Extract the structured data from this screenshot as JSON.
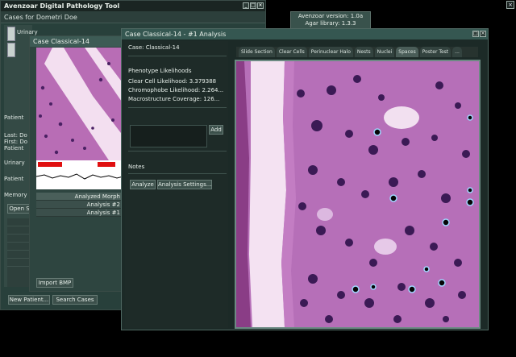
{
  "app": {
    "title": "Avenzoar Digital Pathology Tool",
    "tab": "Cases for Dometri Doe"
  },
  "info": {
    "version_line": "Avenzoar version: 1.0a",
    "library_line": "Agar library: 1.3.3"
  },
  "main": {
    "side_rows": [
      "Urinary",
      "Patient",
      "Last: Do",
      "First: Do",
      "Patient",
      "Urinary",
      "Patient",
      "Memory"
    ],
    "open_button": "Open S",
    "new_patient_button": "New Patient...",
    "search_cases_button": "Search Cases"
  },
  "case_window": {
    "title": "Case Classical-14",
    "analyses_header": "Analyzed Morph",
    "analyses": [
      "Analysis #2",
      "Analysis #1"
    ],
    "import_button": "Import BMP"
  },
  "analysis_window": {
    "title": "Case Classical-14 - #1 Analysis",
    "case_label": "Case: Classical-14",
    "phenotype_header": "Phenotype Likelihoods",
    "clear_cell": "Clear Cell Likelihood: 3.379388",
    "chromophobe": "Chromophobe Likelihood: 2.264...",
    "macrostructure": "Macrostructure Coverage: 126...",
    "add_button": "Add",
    "notes_label": "Notes",
    "analyze_button": "Analyze",
    "settings_button": "Analysis Settings...",
    "tabs": [
      "Slide Section",
      "Clear Cells",
      "Perinuclear Halo",
      "Nests",
      "Nuclei",
      "Spaces",
      "Poster Test",
      "..."
    ]
  },
  "colors": {
    "window_bg": "#1d2a27",
    "titlebar_active": "#355751",
    "tissue_pink": "#c27bc0",
    "nucleus_purple": "#3b1a55"
  }
}
